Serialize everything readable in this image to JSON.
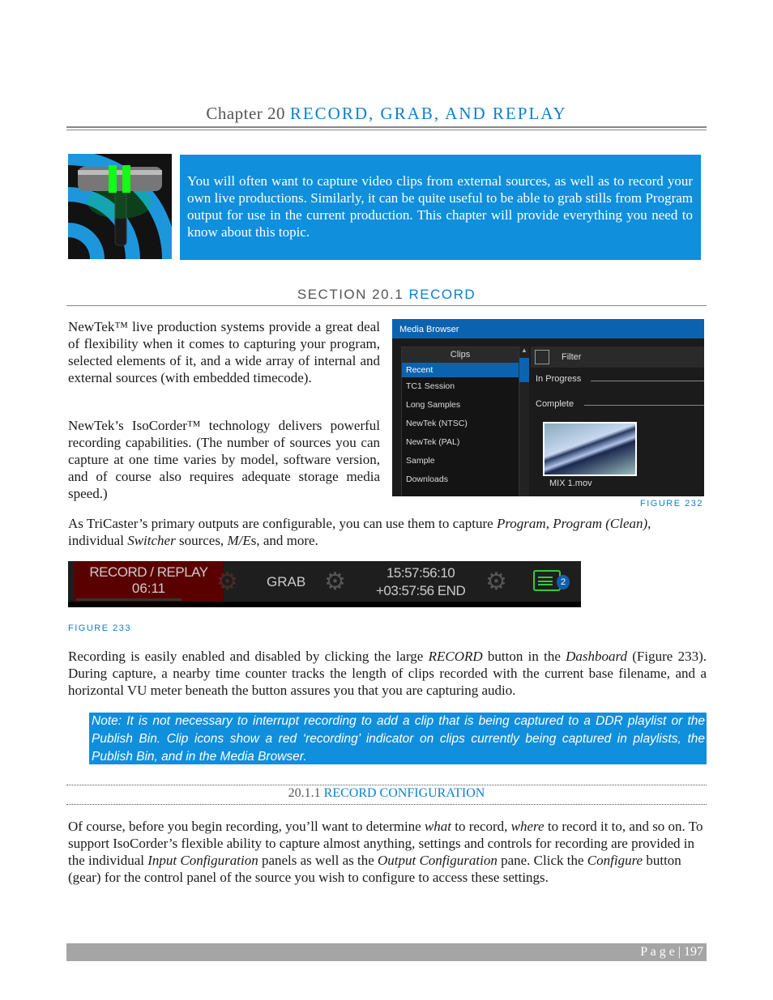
{
  "header": {
    "chapter": "Chapter 20",
    "title": "RECORD, GRAB, AND REPLAY"
  },
  "intro": "You will often want to capture video clips from external sources, as well as to record your own live productions.  Similarly, it can be quite useful to be able to grab stills from Program output for use in the current production.  This chapter will provide everything you need to know about this topic.",
  "section": {
    "label": "SECTION 20.1",
    "title": "RECORD"
  },
  "p1": "NewTek™ live production systems provide a great deal of flexibility when it comes to capturing your program, selected elements of it, and a wide array of internal and external sources (with embedded timecode).",
  "p2": "NewTek’s IsoCorder™ technology delivers powerful recording capabilities.  (The number of sources you can capture at one time varies by model, software version, and of course also requires adequate storage media speed.)",
  "p3": [
    "As TriCaster’s primary outputs are configurable, you can use them to capture ",
    "Program",
    ", ",
    "Program (Clean)",
    ", individual ",
    "Switcher",
    " sources, ",
    "M/E",
    "s, and more."
  ],
  "media_browser": {
    "title": "Media Browser",
    "clips_header": "Clips",
    "items": [
      "Recent",
      "TC1 Session",
      "Long Samples",
      "NewTek (NTSC)",
      "NewTek (PAL)",
      "Sample",
      "Downloads"
    ],
    "selected": "Recent",
    "filter": "Filter",
    "in_progress": "In Progress",
    "complete": "Complete",
    "clip_name": "MIX 1.mov"
  },
  "fig232": "FIGURE 232",
  "dashboard": {
    "record": "RECORD / REPLAY",
    "record_time": "06:11",
    "grab": "GRAB",
    "time": "15:57:56:10",
    "remaining": "+03:57:56 END",
    "notifications": "2"
  },
  "fig233": "FIGURE 233",
  "p4": [
    "Recording is easily enabled and disabled by clicking the large ",
    "RECORD",
    " button in the ",
    "Dashboard",
    " (Figure 233).  During capture, a nearby time counter tracks the length of clips recorded with the current base filename, and a horizontal VU meter beneath the button assures you that you are capturing audio."
  ],
  "note": "Note: It is not necessary to interrupt recording to add a clip that is being captured to a DDR playlist or the Publish Bin.  Clip icons show a red ‘recording’ indicator on clips currently being captured in playlists, the Publish Bin, and in the Media Browser.",
  "subsection": {
    "label": "20.1.1",
    "title": "RECORD CONFIGURATION"
  },
  "p5": [
    "Of course, before you begin recording, you’ll want to determine ",
    "what",
    " to record, ",
    "where",
    " to record it to, and so on.  To support IsoCorder’s flexible ability to capture almost anything, settings and controls for recording are provided in the individual ",
    "Input Configuration",
    " panels as well as the ",
    "Output Configuration",
    " pane.  Click the ",
    "Configure",
    " button (gear) for the control panel of the source you wish to configure to access these settings."
  ],
  "footer": {
    "label": "P a g e",
    "page": "197"
  }
}
